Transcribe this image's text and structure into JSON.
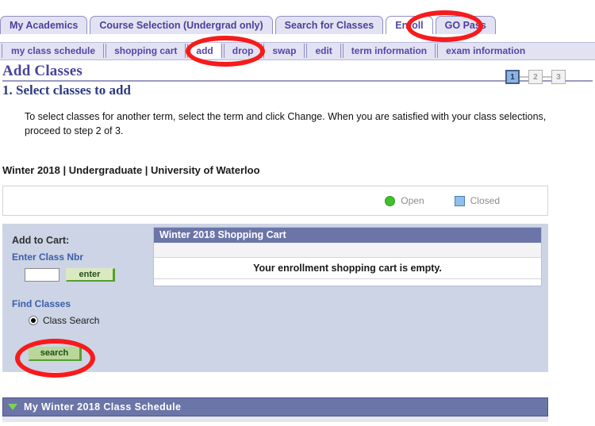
{
  "main_tabs": [
    {
      "label": "My Academics",
      "active": false
    },
    {
      "label": "Course Selection (Undergrad only)",
      "active": false
    },
    {
      "label": "Search for Classes",
      "active": false
    },
    {
      "label": "Enroll",
      "active": true
    },
    {
      "label": "GO Pass",
      "active": false
    }
  ],
  "sub_tabs": [
    {
      "label": "my class schedule",
      "active": false
    },
    {
      "label": "shopping cart",
      "active": false
    },
    {
      "label": "add",
      "active": true
    },
    {
      "label": "drop",
      "active": false
    },
    {
      "label": "swap",
      "active": false
    },
    {
      "label": "edit",
      "active": false
    },
    {
      "label": "term information",
      "active": false
    },
    {
      "label": "exam information",
      "active": false
    }
  ],
  "page": {
    "title": "Add Classes",
    "step_heading": "1. Select classes to add",
    "instructions": "To select classes for another term, select the term and click Change.  When you are satisfied with your class selections, proceed to step 2 of 3.",
    "term_line": "Winter 2018 | Undergraduate | University of Waterloo"
  },
  "steps": [
    {
      "label": "1",
      "state": "on"
    },
    {
      "label": "2",
      "state": "off"
    },
    {
      "label": "3",
      "state": "off"
    }
  ],
  "legend": [
    {
      "label": "Open",
      "marker": "green-circle-icon",
      "color": "#3fbf2a"
    },
    {
      "label": "Closed",
      "marker": "blue-square-icon",
      "color": "#8fc0ea"
    }
  ],
  "add_to_cart": {
    "heading": "Add to Cart:",
    "class_nbr_label": "Enter Class Nbr",
    "class_nbr_value": "",
    "class_nbr_placeholder": "",
    "enter_label": "enter"
  },
  "find_classes": {
    "heading": "Find Classes",
    "options": [
      {
        "label": "Class Search",
        "selected": true
      }
    ],
    "search_label": "search"
  },
  "cart": {
    "header": "Winter 2018 Shopping Cart",
    "empty_message": "Your enrollment shopping cart is empty."
  },
  "schedule_section": {
    "title": "My Winter 2018 Class Schedule",
    "toggle_icon": "triangle-down-icon",
    "expanded": true
  },
  "annotations": [
    {
      "name": "enroll-tab-highlight",
      "color": "#f71b1b"
    },
    {
      "name": "add-subtab-highlight",
      "color": "#f71b1b"
    },
    {
      "name": "search-button-highlight",
      "color": "#f71b1b"
    }
  ]
}
